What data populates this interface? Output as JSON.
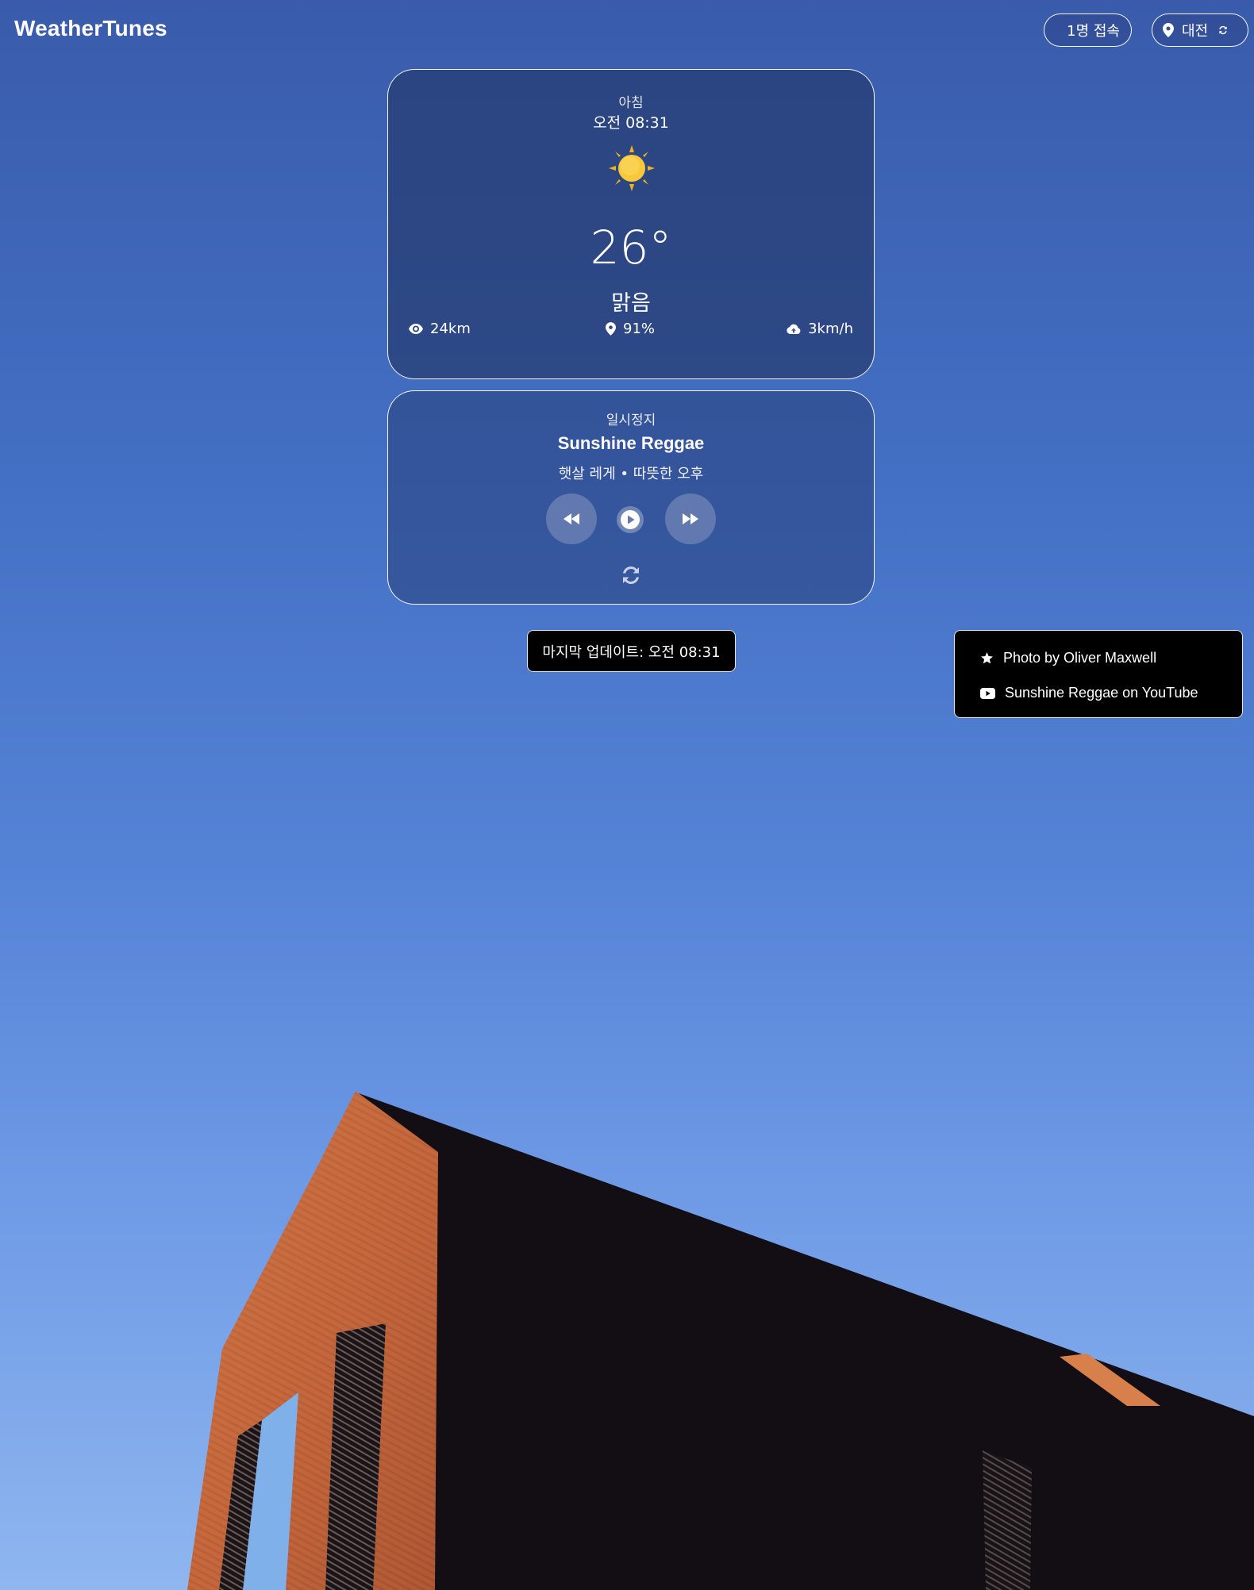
{
  "app": {
    "title": "WeatherTunes"
  },
  "header": {
    "users_label": "1명 접속",
    "location_label": "대전",
    "location_icon": "map-pin-icon",
    "refresh_icon": "refresh-icon"
  },
  "weather": {
    "period": "아침",
    "time": "오전 08:31",
    "icon": "sun-icon",
    "temperature": "26°",
    "condition": "맑음",
    "visibility": "24km",
    "humidity": "91%",
    "wind": "3km/h"
  },
  "player": {
    "status": "일시정지",
    "track": "Sunshine Reggae",
    "subtitle": "햇살 레게 • 따뜻한 오후",
    "controls": [
      "rewind-icon",
      "play-icon",
      "fast-forward-icon",
      "shuffle-refresh-icon"
    ]
  },
  "footer": {
    "last_updated": "마지막 업데이트: 오전 08:31"
  },
  "credits": {
    "photo": "Photo by Oliver Maxwell",
    "youtube": "Sunshine Reggae on YouTube"
  },
  "colors": {
    "sky_top": "#3a5bab",
    "sky_bottom": "#8fb6ef",
    "building_copper": "#c4683a",
    "building_dark": "#120e14",
    "sun": "#f6c233"
  }
}
